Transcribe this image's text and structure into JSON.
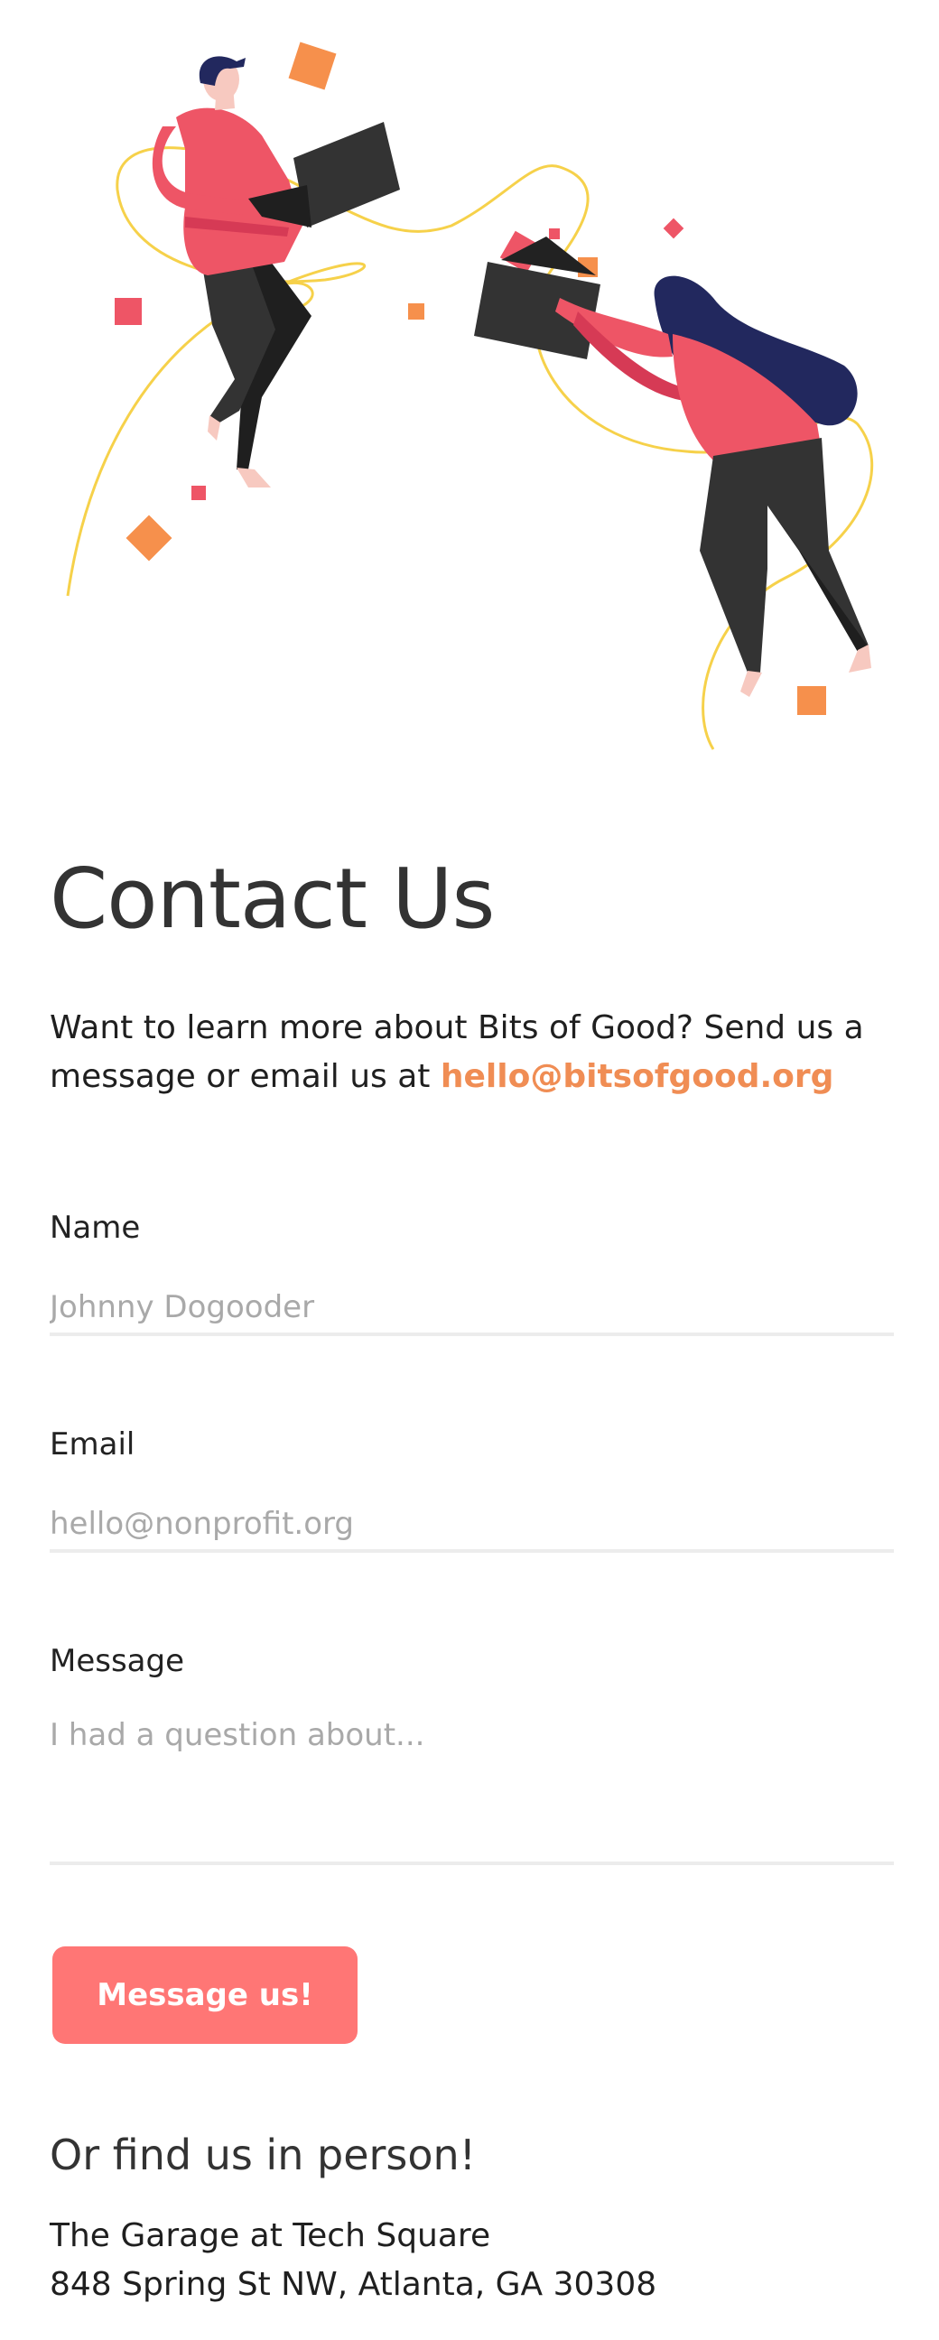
{
  "contact": {
    "title": "Contact Us",
    "intro_text": "Want to learn more about Bits of Good? Send us a message or email us at",
    "email_link": "hello@bitsofgood.org"
  },
  "form": {
    "name": {
      "label": "Name",
      "placeholder": "Johnny Dogooder",
      "value": ""
    },
    "email": {
      "label": "Email",
      "placeholder": "hello@nonprofit.org",
      "value": ""
    },
    "message": {
      "label": "Message",
      "placeholder": "I had a question about...",
      "value": ""
    },
    "submit_label": "Message us!"
  },
  "in_person": {
    "heading": "Or find us in person!",
    "address_line1": "The Garage at Tech Square",
    "address_line2": "848 Spring St NW, Atlanta, GA 30308"
  },
  "colors": {
    "accent_orange": "#f08d54",
    "button_coral": "#ff7675",
    "illustration_pink": "#ee5566",
    "illustration_navy": "#22285e",
    "illustration_dark": "#333333",
    "illustration_yellow": "#f6d14a"
  },
  "icons": {
    "hero": "people-passing-laptops-illustration"
  }
}
